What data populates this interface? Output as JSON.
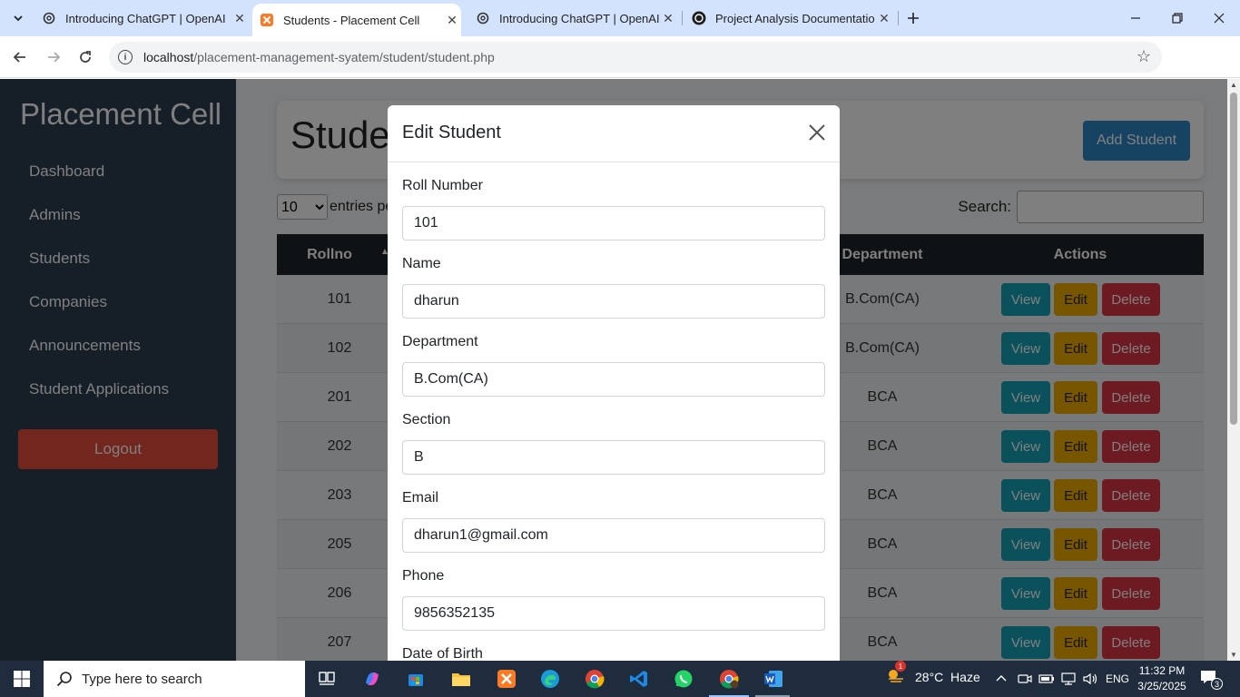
{
  "browser": {
    "tabs": [
      {
        "title": "Introducing ChatGPT | OpenAI",
        "active": false,
        "icon": "openai-icon"
      },
      {
        "title": "Students - Placement Cell",
        "active": true,
        "icon": "xampp-icon"
      },
      {
        "title": "Introducing ChatGPT | OpenAI",
        "active": false,
        "icon": "openai-icon"
      },
      {
        "title": "Project Analysis Documentation",
        "active": false,
        "icon": "openai-icon"
      }
    ],
    "url_host": "localhost",
    "url_path": "/placement-management-syatem/student/student.php"
  },
  "sidebar": {
    "brand": "Placement Cell",
    "items": [
      "Dashboard",
      "Admins",
      "Students",
      "Companies",
      "Announcements",
      "Student Applications"
    ],
    "logout": "Logout"
  },
  "main": {
    "title": "Stude",
    "add_button": "Add Student",
    "entries_value": "10",
    "entries_label": "entries pe",
    "search_label": "Search:",
    "columns": {
      "rollno": "Rollno",
      "department": "Department",
      "actions": "Actions"
    },
    "rows": [
      {
        "rollno": "101",
        "department": "B.Com(CA)"
      },
      {
        "rollno": "102",
        "department": "B.Com(CA)"
      },
      {
        "rollno": "201",
        "department": "BCA"
      },
      {
        "rollno": "202",
        "department": "BCA"
      },
      {
        "rollno": "203",
        "department": "BCA"
      },
      {
        "rollno": "205",
        "department": "BCA"
      },
      {
        "rollno": "206",
        "department": "BCA"
      },
      {
        "rollno": "207",
        "department": "BCA"
      }
    ],
    "action_labels": {
      "view": "View",
      "edit": "Edit",
      "delete": "Delete"
    }
  },
  "modal": {
    "title": "Edit Student",
    "fields": [
      {
        "label": "Roll Number",
        "value": "101"
      },
      {
        "label": "Name",
        "value": "dharun"
      },
      {
        "label": "Department",
        "value": "B.Com(CA)"
      },
      {
        "label": "Section",
        "value": "B"
      },
      {
        "label": "Email",
        "value": "dharun1@gmail.com"
      },
      {
        "label": "Phone",
        "value": "9856352135"
      },
      {
        "label": "Date of Birth",
        "value": ""
      }
    ]
  },
  "taskbar": {
    "search_placeholder": "Type here to search",
    "weather": "28°C  Haze",
    "weather_badge": "1",
    "language": "ENG",
    "time": "11:32 PM",
    "date": "3/25/2025",
    "notification_count": "3"
  },
  "colors": {
    "sidebar": "#2c3e50",
    "primary": "#2f86c6",
    "logout": "#e74c3c",
    "view": "#17a2b8",
    "edit": "#f0ad00",
    "delete": "#dc3545"
  }
}
